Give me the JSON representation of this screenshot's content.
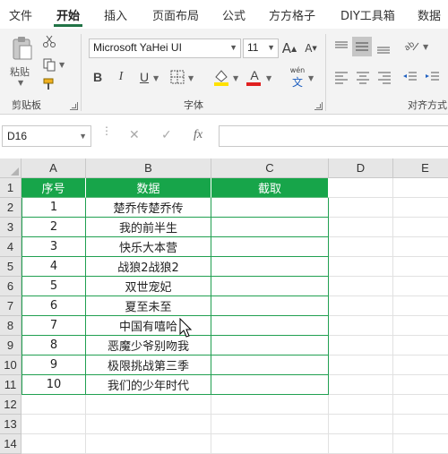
{
  "ribbon_tabs": [
    "文件",
    "开始",
    "插入",
    "页面布局",
    "公式",
    "方方格子",
    "DIY工具箱",
    "数据"
  ],
  "active_tab": "开始",
  "ribbon": {
    "clipboard": {
      "paste_label": "粘贴",
      "group_label": "剪贴板"
    },
    "font": {
      "font_name": "Microsoft YaHei UI",
      "font_size": "11",
      "group_label": "字体",
      "bold": "B",
      "italic": "I",
      "underline": "U",
      "wen_pinyin": "wén",
      "wen_char": "文"
    },
    "alignment": {
      "group_label": "对齐方式"
    }
  },
  "formula_bar": {
    "name_box": "D16",
    "fx_label": "fx",
    "formula": ""
  },
  "columns": [
    "A",
    "B",
    "C",
    "D",
    "E"
  ],
  "rows": [
    "1",
    "2",
    "3",
    "4",
    "5",
    "6",
    "7",
    "8",
    "9",
    "10",
    "11",
    "12",
    "13",
    "14"
  ],
  "table": {
    "headers": [
      "序号",
      "数据",
      "截取"
    ],
    "data": [
      [
        "1",
        "楚乔传楚乔传",
        ""
      ],
      [
        "2",
        "我的前半生",
        ""
      ],
      [
        "3",
        "快乐大本营",
        ""
      ],
      [
        "4",
        "战狼2战狼2",
        ""
      ],
      [
        "5",
        "双世宠妃",
        ""
      ],
      [
        "6",
        "夏至未至",
        ""
      ],
      [
        "7",
        "中国有嘻哈",
        ""
      ],
      [
        "8",
        "恶魔少爷别吻我",
        ""
      ],
      [
        "9",
        "极限挑战第三季",
        ""
      ],
      [
        "10",
        "我们的少年时代",
        ""
      ]
    ]
  },
  "colors": {
    "accent": "#217346",
    "table_header_bg": "#17a54a",
    "table_border": "#21a051",
    "font_highlight": "#ffe100",
    "font_color": "#e02020"
  }
}
